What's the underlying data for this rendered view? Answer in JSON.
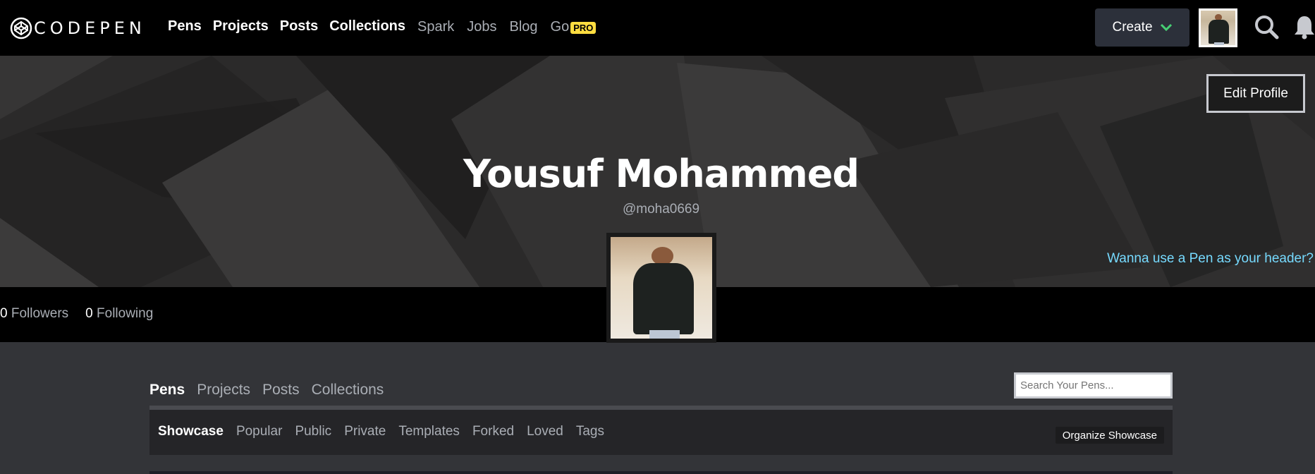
{
  "header": {
    "logo_text": "CODEPEN",
    "nav_main": [
      "Pens",
      "Projects",
      "Posts",
      "Collections"
    ],
    "nav_secondary": [
      "Spark",
      "Jobs",
      "Blog",
      "Go"
    ],
    "pro_badge": "PRO",
    "create_label": "Create",
    "icons": [
      "search-icon",
      "bell-icon",
      "chevron-down-icon"
    ],
    "accent_color": "#47cf73"
  },
  "profile": {
    "edit_label": "Edit Profile",
    "name": "Yousuf Mohammed",
    "handle": "@moha0669",
    "pen_header_link": "Wanna use a Pen as your header?",
    "followers_count": "0",
    "followers_label": "Followers",
    "following_count": "0",
    "following_label": "Following"
  },
  "content": {
    "tabs": [
      "Pens",
      "Projects",
      "Posts",
      "Collections"
    ],
    "active_tab": "Pens",
    "search_placeholder": "Search Your Pens...",
    "subtabs": [
      "Showcase",
      "Popular",
      "Public",
      "Private",
      "Templates",
      "Forked",
      "Loved",
      "Tags"
    ],
    "active_subtab": "Showcase",
    "organize_label": "Organize Showcase"
  }
}
